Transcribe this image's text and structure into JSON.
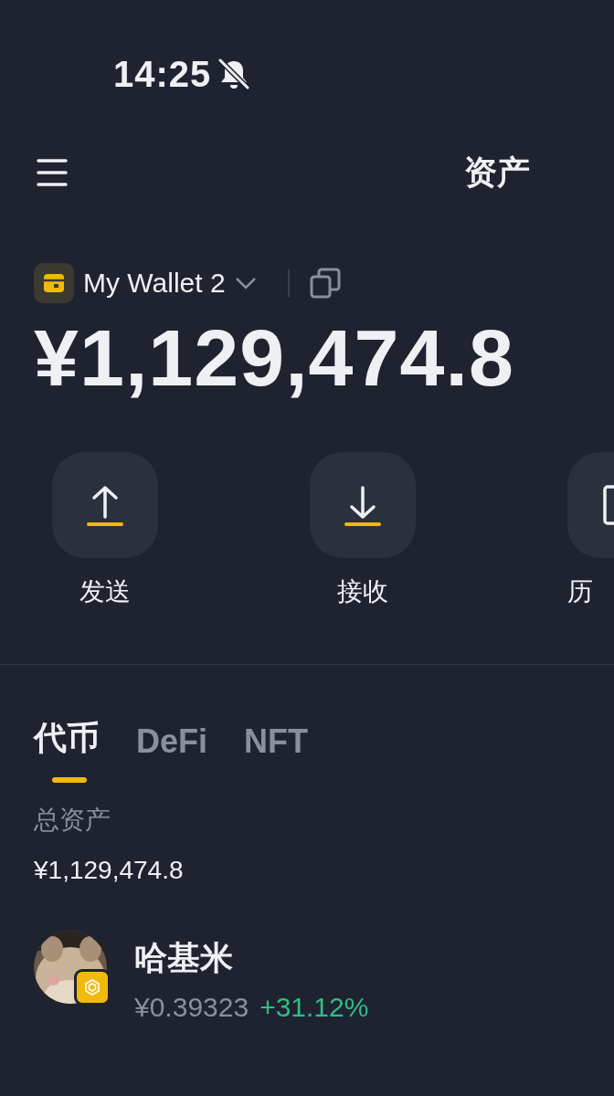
{
  "status_bar": {
    "time": "14:25"
  },
  "header": {
    "title": "资产"
  },
  "wallet": {
    "name": "My Wallet 2",
    "balance": "¥1,129,474.8"
  },
  "actions": [
    {
      "kind": "send",
      "label": "发送"
    },
    {
      "kind": "receive",
      "label": "接收"
    },
    {
      "kind": "history",
      "label": "历"
    }
  ],
  "tabs": [
    {
      "label": "代币",
      "selected": true
    },
    {
      "label": "DeFi",
      "selected": false
    },
    {
      "label": "NFT",
      "selected": false
    }
  ],
  "total": {
    "label": "总资产",
    "value": "¥1,129,474.8"
  },
  "tokens": [
    {
      "kind": "picture",
      "name": "哈基米",
      "price": "¥0.39323",
      "change": "+31.12%"
    }
  ]
}
